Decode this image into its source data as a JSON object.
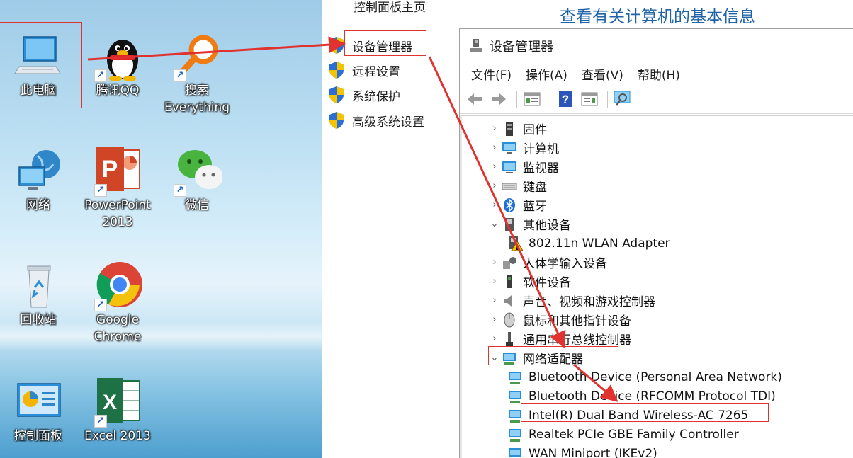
{
  "desktop": {
    "icons": [
      {
        "label": "此电脑",
        "icon": "computer-icon"
      },
      {
        "label": "腾讯QQ",
        "icon": "qq-penguin-icon"
      },
      {
        "label": "搜索",
        "label2": "Everything",
        "icon": "magnifier-icon"
      },
      {
        "label": "网络",
        "icon": "network-globe-icon"
      },
      {
        "label": "PowerPoint",
        "label2": "2013",
        "icon": "powerpoint-icon"
      },
      {
        "label": "微信",
        "icon": "wechat-icon"
      },
      {
        "label": "回收站",
        "icon": "recycle-bin-icon"
      },
      {
        "label": "Google",
        "label2": "Chrome",
        "icon": "chrome-icon"
      },
      {
        "label": "控制面板",
        "icon": "control-panel-icon"
      },
      {
        "label": "Excel 2013",
        "icon": "excel-icon"
      }
    ]
  },
  "control_panel": {
    "home": "控制面板主页",
    "links": [
      {
        "label": "设备管理器"
      },
      {
        "label": "远程设置"
      },
      {
        "label": "系统保护"
      },
      {
        "label": "高级系统设置"
      }
    ]
  },
  "heading": "查看有关计算机的基本信息",
  "device_manager": {
    "title": "设备管理器",
    "menus": [
      "文件(F)",
      "操作(A)",
      "查看(V)",
      "帮助(H)"
    ],
    "toolbar": [
      "back-arrow-icon",
      "forward-arrow-icon",
      "properties-icon",
      "help-icon",
      "update-driver-icon",
      "scan-hardware-icon"
    ],
    "tree": [
      {
        "label": "固件",
        "expander": "›",
        "icon": "firmware-icon",
        "level": 0
      },
      {
        "label": "计算机",
        "expander": "›",
        "icon": "computer-icon",
        "level": 0
      },
      {
        "label": "监视器",
        "expander": "›",
        "icon": "monitor-icon",
        "level": 0
      },
      {
        "label": "键盘",
        "expander": "›",
        "icon": "keyboard-icon",
        "level": 0
      },
      {
        "label": "蓝牙",
        "expander": "›",
        "icon": "bluetooth-icon",
        "level": 0
      },
      {
        "label": "其他设备",
        "expander": "⌄",
        "icon": "other-devices-icon",
        "level": 0
      },
      {
        "label": "802.11n WLAN Adapter",
        "expander": "",
        "icon": "warning-device-icon",
        "level": 1
      },
      {
        "label": "人体学输入设备",
        "expander": "›",
        "icon": "hid-icon",
        "level": 0
      },
      {
        "label": "软件设备",
        "expander": "›",
        "icon": "software-device-icon",
        "level": 0
      },
      {
        "label": "声音、视频和游戏控制器",
        "expander": "›",
        "icon": "speaker-icon",
        "level": 0
      },
      {
        "label": "鼠标和其他指针设备",
        "expander": "›",
        "icon": "mouse-icon",
        "level": 0
      },
      {
        "label": "通用串行总线控制器",
        "expander": "›",
        "icon": "usb-icon",
        "level": 0
      },
      {
        "label": "网络适配器",
        "expander": "⌄",
        "icon": "network-adapter-icon",
        "level": 0
      },
      {
        "label": "Bluetooth Device (Personal Area Network)",
        "expander": "",
        "icon": "network-adapter-icon",
        "level": 1
      },
      {
        "label": "Bluetooth Device (RFCOMM Protocol TDI)",
        "expander": "",
        "icon": "network-adapter-icon",
        "level": 1
      },
      {
        "label": "Intel(R) Dual Band Wireless-AC 7265",
        "expander": "",
        "icon": "network-adapter-icon",
        "level": 1
      },
      {
        "label": "Realtek PCIe GBE Family Controller",
        "expander": "",
        "icon": "network-adapter-icon",
        "level": 1
      },
      {
        "label": "WAN Miniport (IKEv2)",
        "expander": "",
        "icon": "network-adapter-icon",
        "level": 1
      }
    ]
  },
  "colors": {
    "annotation_red": "#e0322f",
    "heading_blue": "#1f63a8"
  }
}
